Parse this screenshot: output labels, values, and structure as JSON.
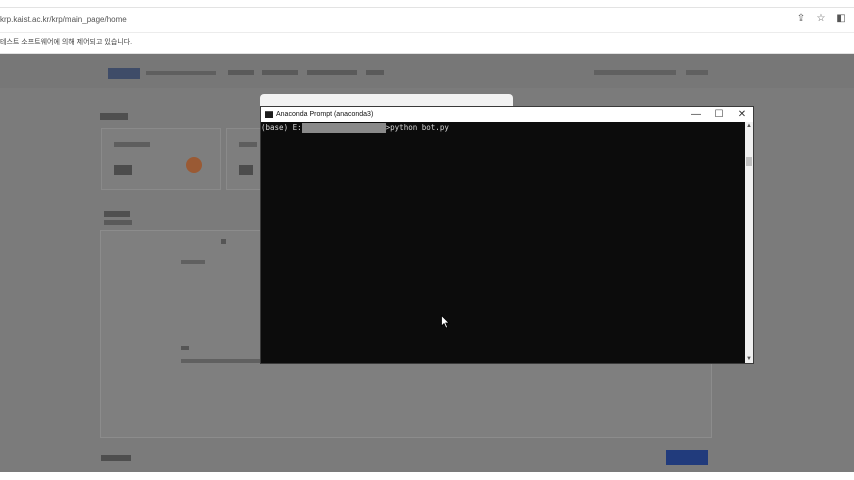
{
  "browser": {
    "url": "krp.kaist.ac.kr/krp/main_page/home",
    "infobar_text": "테스트 소프트웨어에 의해 제어되고 있습니다.",
    "icons": [
      "share-icon",
      "star-icon",
      "sidebar-icon"
    ]
  },
  "console": {
    "title": "Anaconda Prompt (anaconda3)",
    "prompt_prefix": "(base) E:",
    "command": ">python bot.py",
    "controls": {
      "minimize": "—",
      "maximize": "☐",
      "close": "✕"
    }
  },
  "colors": {
    "console_bg": "#0c0c0c",
    "overlay": "#7b7b7b",
    "primary_button": "#213b7c",
    "accent_dot": "#9a5a34"
  }
}
